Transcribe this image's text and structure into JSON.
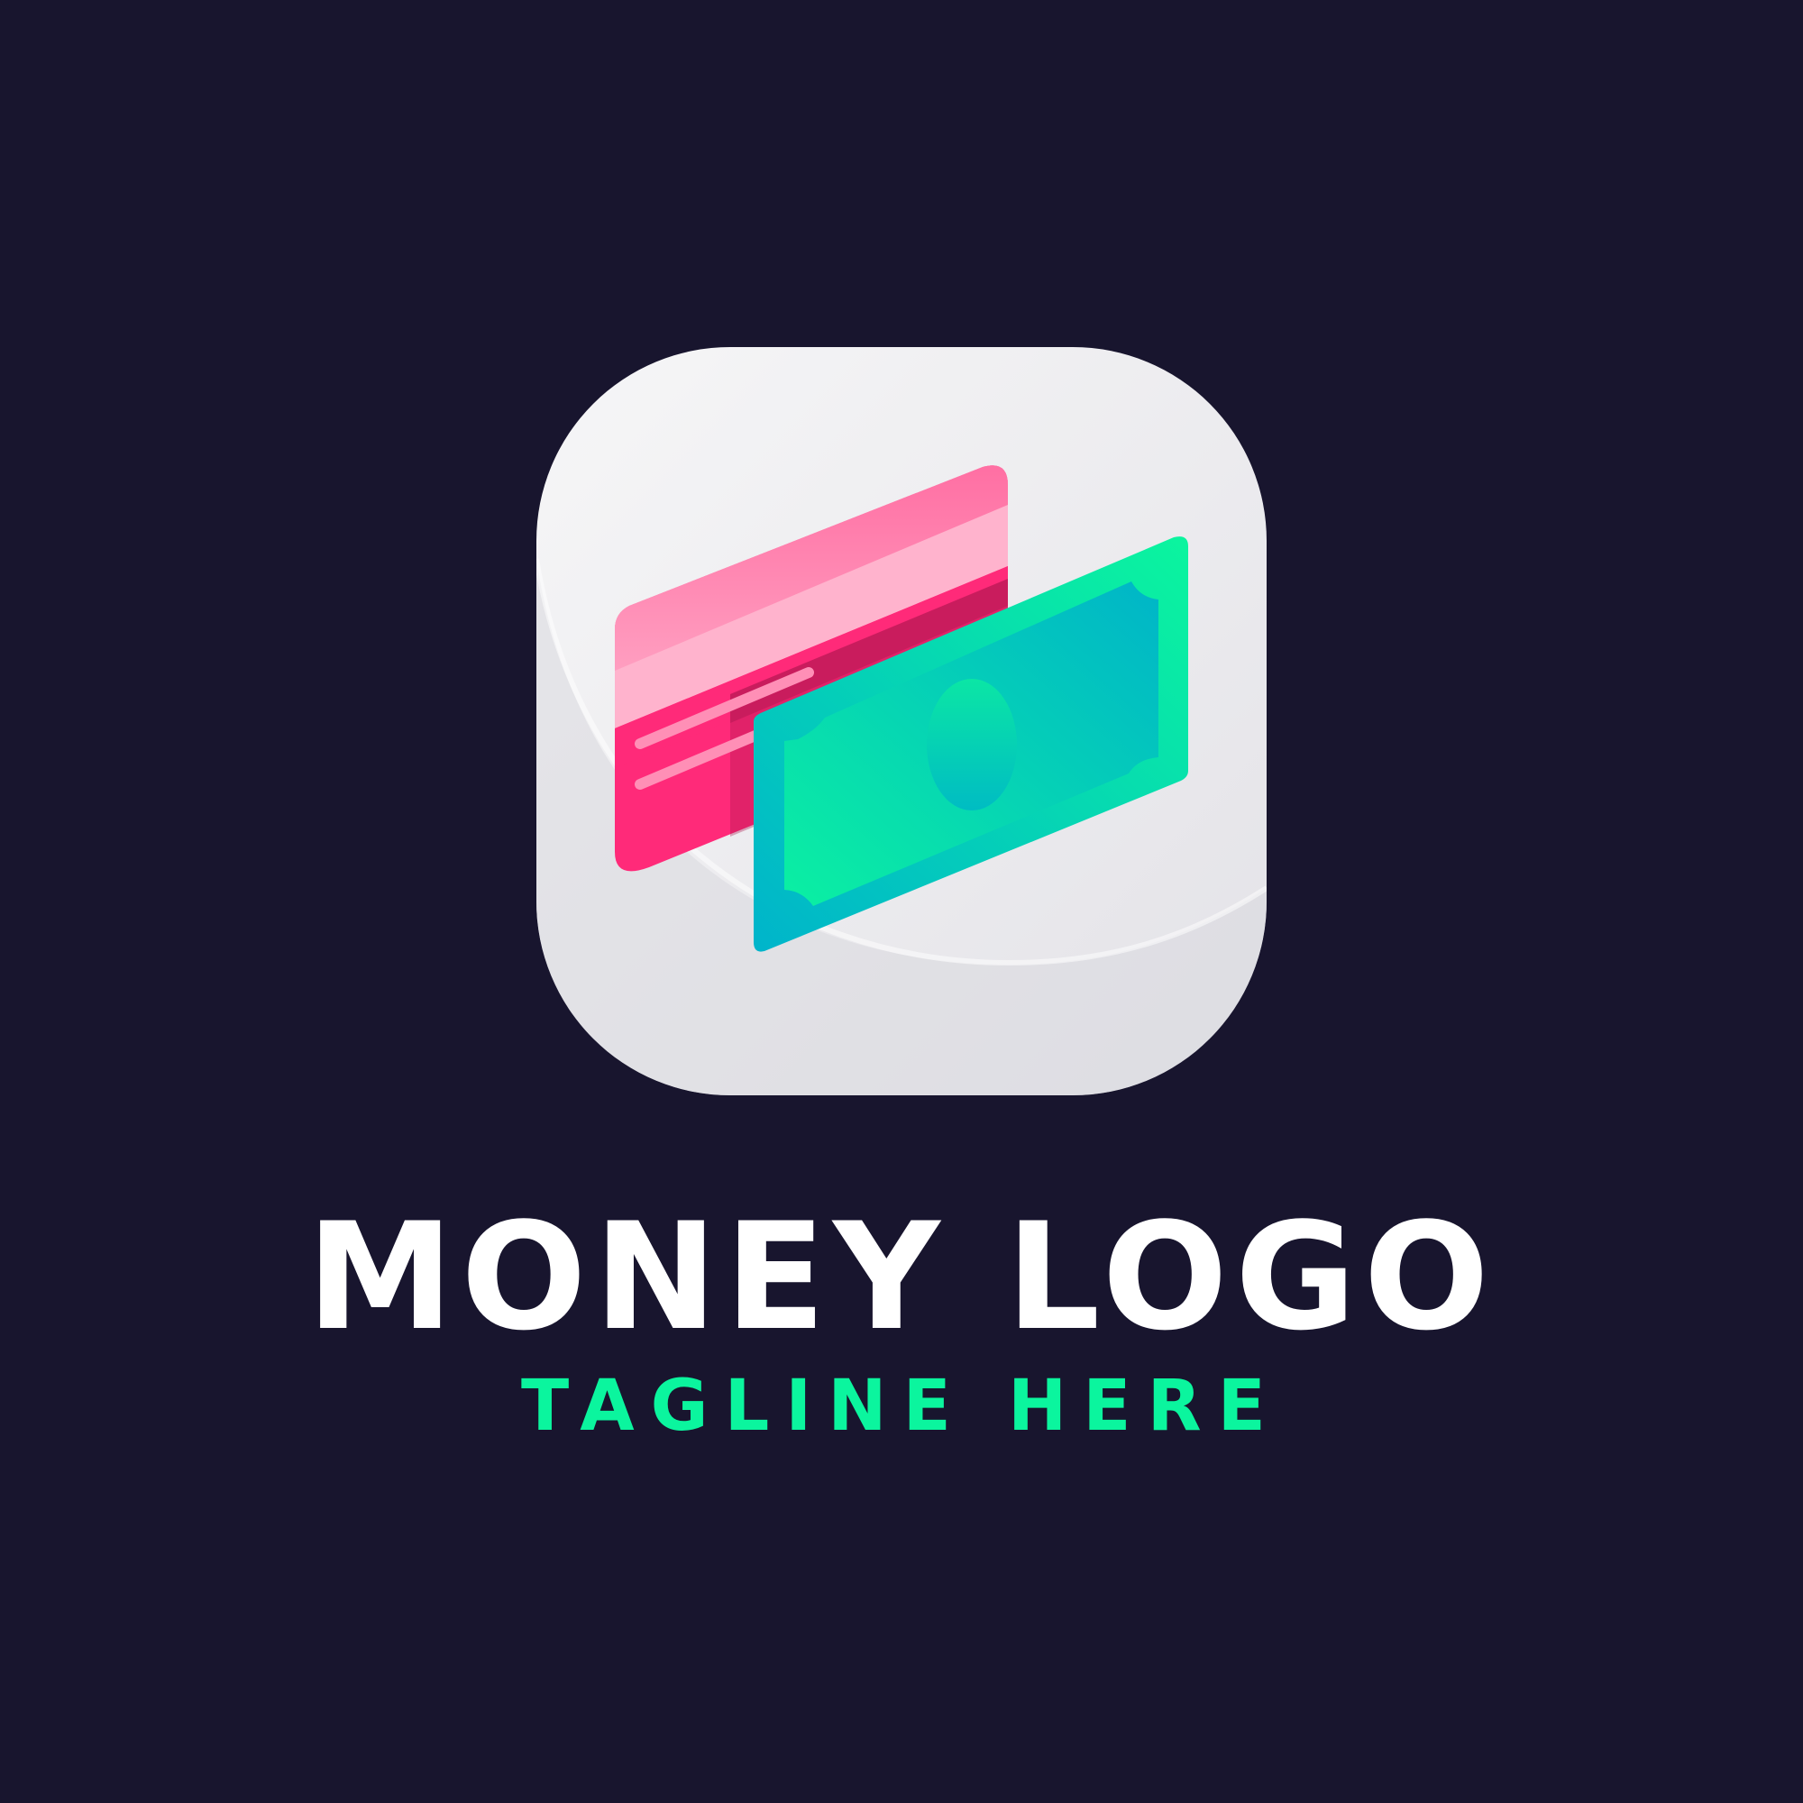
{
  "logo": {
    "name": "MONEY LOGO",
    "tagline": "TAGLINE HERE"
  },
  "colors": {
    "background": "#18152e",
    "tile": "#f2f2f4",
    "tile_shadow": "#dcdbe0",
    "card_pink": "#ff2a79",
    "card_light_pink": "#ffb3cd",
    "card_stripe": "#c21c5a",
    "bill_teal": "#00b5c8",
    "bill_green": "#0bf59e",
    "wordmark": "#ffffff",
    "tagline": "#0bf59e"
  },
  "icons": {
    "tile": "rounded-square-tile",
    "card": "credit-card-icon",
    "bill": "banknote-icon"
  }
}
